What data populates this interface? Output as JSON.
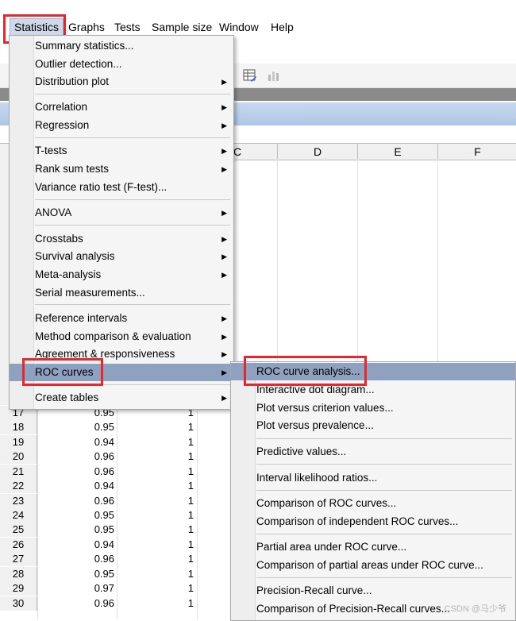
{
  "menubar": {
    "items": [
      "Statistics",
      "Graphs",
      "Tests",
      "Sample size",
      "Window",
      "Help"
    ]
  },
  "spreadsheet": {
    "columns": [
      "C",
      "D",
      "E",
      "F"
    ],
    "rows": [
      {
        "n": "17",
        "v1": "0.95",
        "v2": "1"
      },
      {
        "n": "18",
        "v1": "0.95",
        "v2": "1"
      },
      {
        "n": "19",
        "v1": "0.94",
        "v2": "1"
      },
      {
        "n": "20",
        "v1": "0.96",
        "v2": "1"
      },
      {
        "n": "21",
        "v1": "0.96",
        "v2": "1"
      },
      {
        "n": "22",
        "v1": "0.94",
        "v2": "1"
      },
      {
        "n": "23",
        "v1": "0.96",
        "v2": "1"
      },
      {
        "n": "24",
        "v1": "0.95",
        "v2": "1"
      },
      {
        "n": "25",
        "v1": "0.95",
        "v2": "1"
      },
      {
        "n": "26",
        "v1": "0.94",
        "v2": "1"
      },
      {
        "n": "27",
        "v1": "0.96",
        "v2": "1"
      },
      {
        "n": "28",
        "v1": "0.95",
        "v2": "1"
      },
      {
        "n": "29",
        "v1": "0.97",
        "v2": "1"
      },
      {
        "n": "30",
        "v1": "0.96",
        "v2": "1"
      }
    ]
  },
  "statistics_menu": {
    "items": [
      {
        "label": "Summary statistics...",
        "submenu": false
      },
      {
        "label": "Outlier detection...",
        "submenu": false
      },
      {
        "label": "Distribution plot",
        "submenu": true
      },
      {
        "label": "Correlation",
        "submenu": true
      },
      {
        "label": "Regression",
        "submenu": true
      },
      {
        "label": "T-tests",
        "submenu": true
      },
      {
        "label": "Rank sum tests",
        "submenu": true
      },
      {
        "label": "Variance ratio test (F-test)...",
        "submenu": false
      },
      {
        "label": "ANOVA",
        "submenu": true
      },
      {
        "label": "Crosstabs",
        "submenu": true
      },
      {
        "label": "Survival analysis",
        "submenu": true
      },
      {
        "label": "Meta-analysis",
        "submenu": true
      },
      {
        "label": "Serial measurements...",
        "submenu": false
      },
      {
        "label": "Reference intervals",
        "submenu": true
      },
      {
        "label": "Method comparison & evaluation",
        "submenu": true
      },
      {
        "label": "Agreement & responsiveness",
        "submenu": true
      },
      {
        "label": "ROC curves",
        "submenu": true
      },
      {
        "label": "Create tables",
        "submenu": true
      }
    ]
  },
  "roc_submenu": {
    "items": [
      "ROC curve analysis...",
      "Interactive dot diagram...",
      "Plot versus criterion values...",
      "Plot versus prevalence...",
      "Predictive values...",
      "Interval likelihood ratios...",
      "Comparison of ROC curves...",
      "Comparison of independent ROC curves...",
      "Partial area under ROC curve...",
      "Comparison of partial areas under ROC curve...",
      "Precision-Recall curve...",
      "Comparison of Precision-Recall curves..."
    ]
  },
  "watermark": "CSDN @马少爷",
  "colors": {
    "highlight_box": "#e8262b",
    "menu_active": "#8ea2bf"
  }
}
